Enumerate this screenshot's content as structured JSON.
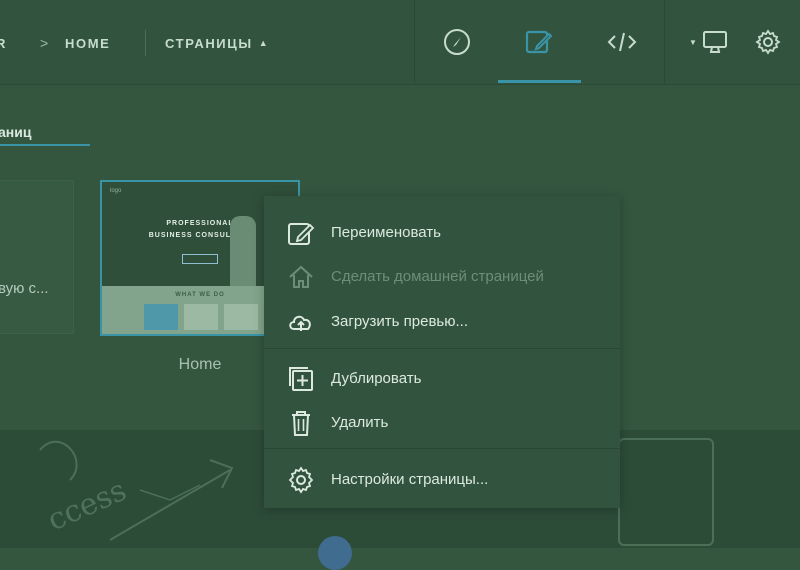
{
  "topbar": {
    "breadcrumb_cut": "R",
    "breadcrumb_separator": ">",
    "breadcrumb_home": "HOME",
    "pages_menu_label": "СТРАНИЦЫ",
    "pages_menu_caret": "▲",
    "tools": [
      {
        "name": "compass-icon"
      },
      {
        "name": "edit-icon",
        "active": true
      },
      {
        "name": "code-icon"
      }
    ],
    "device_caret": "▼"
  },
  "subtabs": {
    "active_label": "аниц"
  },
  "pages": {
    "left_card_text": "вую с...",
    "thumbnail": {
      "nav_text": "logo",
      "hero_line1": "PROFESSIONAL",
      "hero_line2": "BUSINESS CONSULTING",
      "section_title": "WHAT WE DO"
    },
    "home_caption": "Home"
  },
  "context_menu": {
    "items": [
      {
        "label": "Переименовать",
        "icon": "rename-icon",
        "disabled": false
      },
      {
        "label": "Сделать домашней страницей",
        "icon": "home-icon",
        "disabled": true
      },
      {
        "label": "Загрузить превью...",
        "icon": "cloud-upload-icon",
        "disabled": false
      },
      {
        "label": "Дублировать",
        "icon": "duplicate-icon",
        "disabled": false
      },
      {
        "label": "Удалить",
        "icon": "trash-icon",
        "disabled": false
      },
      {
        "label": "Настройки страницы...",
        "icon": "settings-icon",
        "disabled": false
      }
    ]
  },
  "background_band": {
    "doodle_text": "ccess"
  },
  "colors": {
    "accent": "#3a94a8",
    "overlay_green": "#34563f"
  }
}
